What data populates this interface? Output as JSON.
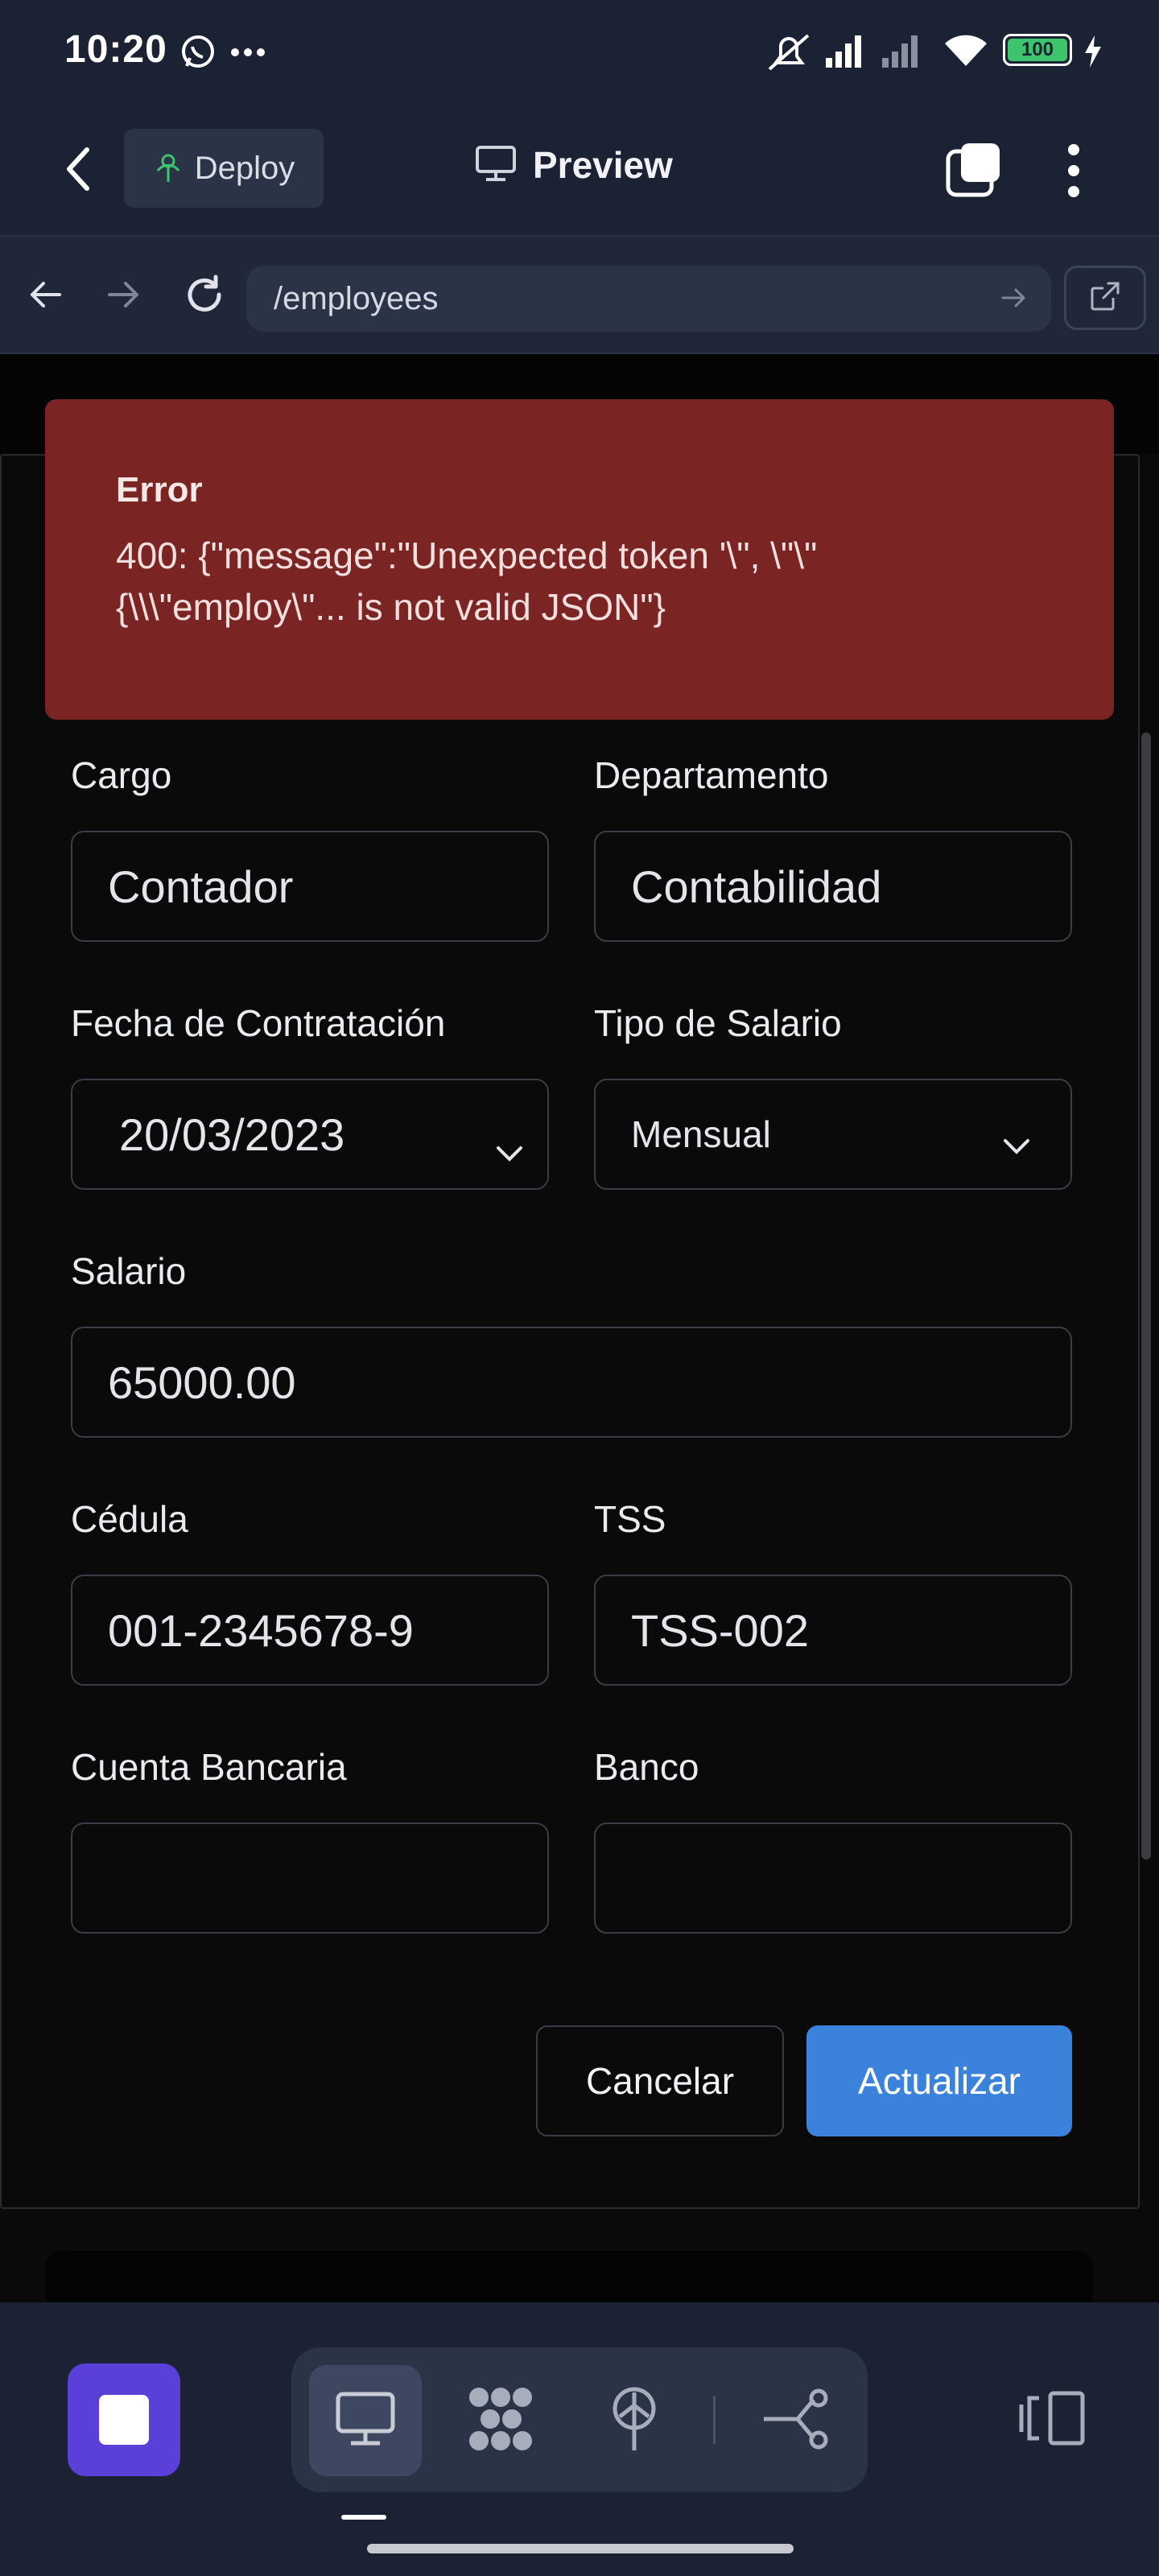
{
  "status_bar": {
    "time": "10:20",
    "battery": "100",
    "icons": [
      "whatsapp-icon",
      "more-dots-icon",
      "mute-icon",
      "signal-icon",
      "signal-off-icon",
      "wifi-icon",
      "battery-icon",
      "charging-icon"
    ]
  },
  "header": {
    "deploy_label": "Deploy",
    "title": "Preview"
  },
  "browser": {
    "url": "/employees"
  },
  "error": {
    "title": "Error",
    "message": "400: {\"message\":\"Unexpected token '\\\", \\\"\\\"\n{\\\\\\\"employ\\\"... is not valid JSON\"}"
  },
  "form": {
    "cargo": {
      "label": "Cargo",
      "value": "Contador"
    },
    "departamento": {
      "label": "Departamento",
      "value": "Contabilidad"
    },
    "fecha": {
      "label": "Fecha de Contratación",
      "value": "20/03/2023"
    },
    "tipo_salario": {
      "label": "Tipo de Salario",
      "value": "Mensual"
    },
    "salario": {
      "label": "Salario",
      "value": "65000.00"
    },
    "cedula": {
      "label": "Cédula",
      "value": "001-2345678-9"
    },
    "tss": {
      "label": "TSS",
      "value": "TSS-002"
    },
    "cuenta": {
      "label": "Cuenta Bancaria",
      "value": ""
    },
    "banco": {
      "label": "Banco",
      "value": ""
    },
    "cancel_label": "Cancelar",
    "submit_label": "Actualizar"
  },
  "colors": {
    "error_bg": "#7a2523",
    "primary": "#3b82dd",
    "stop": "#5b3fd9",
    "deploy_icon": "#3ec46d"
  }
}
